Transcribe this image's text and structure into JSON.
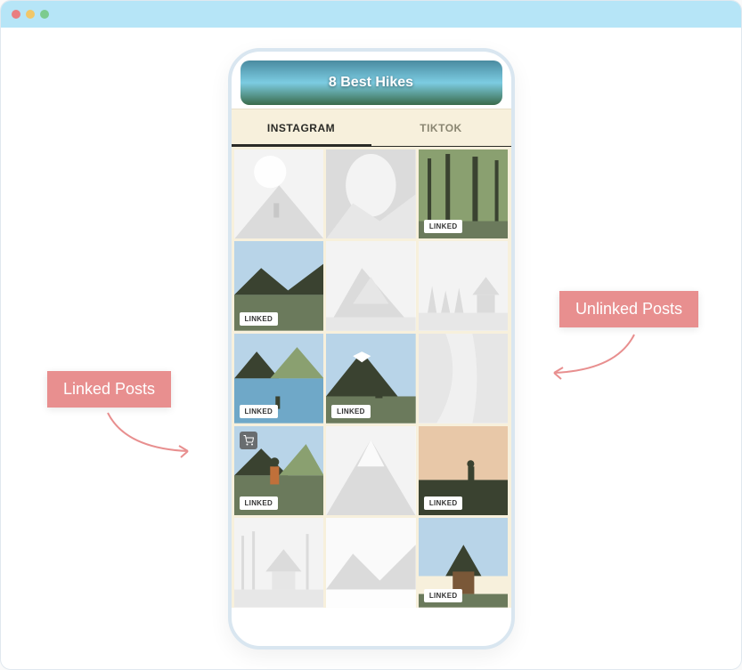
{
  "header": {
    "title": "8 Best Hikes"
  },
  "tabs": {
    "items": [
      {
        "label": "INSTAGRAM",
        "active": true
      },
      {
        "label": "TIKTOK",
        "active": false
      }
    ]
  },
  "posts": [
    {
      "linked": false,
      "cart": false,
      "scene": "hike-sun"
    },
    {
      "linked": false,
      "cart": false,
      "scene": "cave"
    },
    {
      "linked": true,
      "cart": false,
      "scene": "forest"
    },
    {
      "linked": true,
      "cart": false,
      "scene": "ridge"
    },
    {
      "linked": false,
      "cart": false,
      "scene": "tent"
    },
    {
      "linked": false,
      "cart": false,
      "scene": "cabin-trees"
    },
    {
      "linked": true,
      "cart": false,
      "scene": "lake"
    },
    {
      "linked": true,
      "cart": false,
      "scene": "hiker-mountain"
    },
    {
      "linked": false,
      "cart": false,
      "scene": "river"
    },
    {
      "linked": true,
      "cart": true,
      "scene": "backpacker"
    },
    {
      "linked": false,
      "cart": false,
      "scene": "summit"
    },
    {
      "linked": true,
      "cart": false,
      "scene": "sunset"
    },
    {
      "linked": false,
      "cart": false,
      "scene": "woods-cabin"
    },
    {
      "linked": false,
      "cart": false,
      "scene": "snow"
    },
    {
      "linked": true,
      "cart": false,
      "scene": "hut"
    }
  ],
  "badges": {
    "linked_label": "LINKED"
  },
  "annotations": {
    "linked": "Linked Posts",
    "unlinked": "Unlinked Posts"
  }
}
